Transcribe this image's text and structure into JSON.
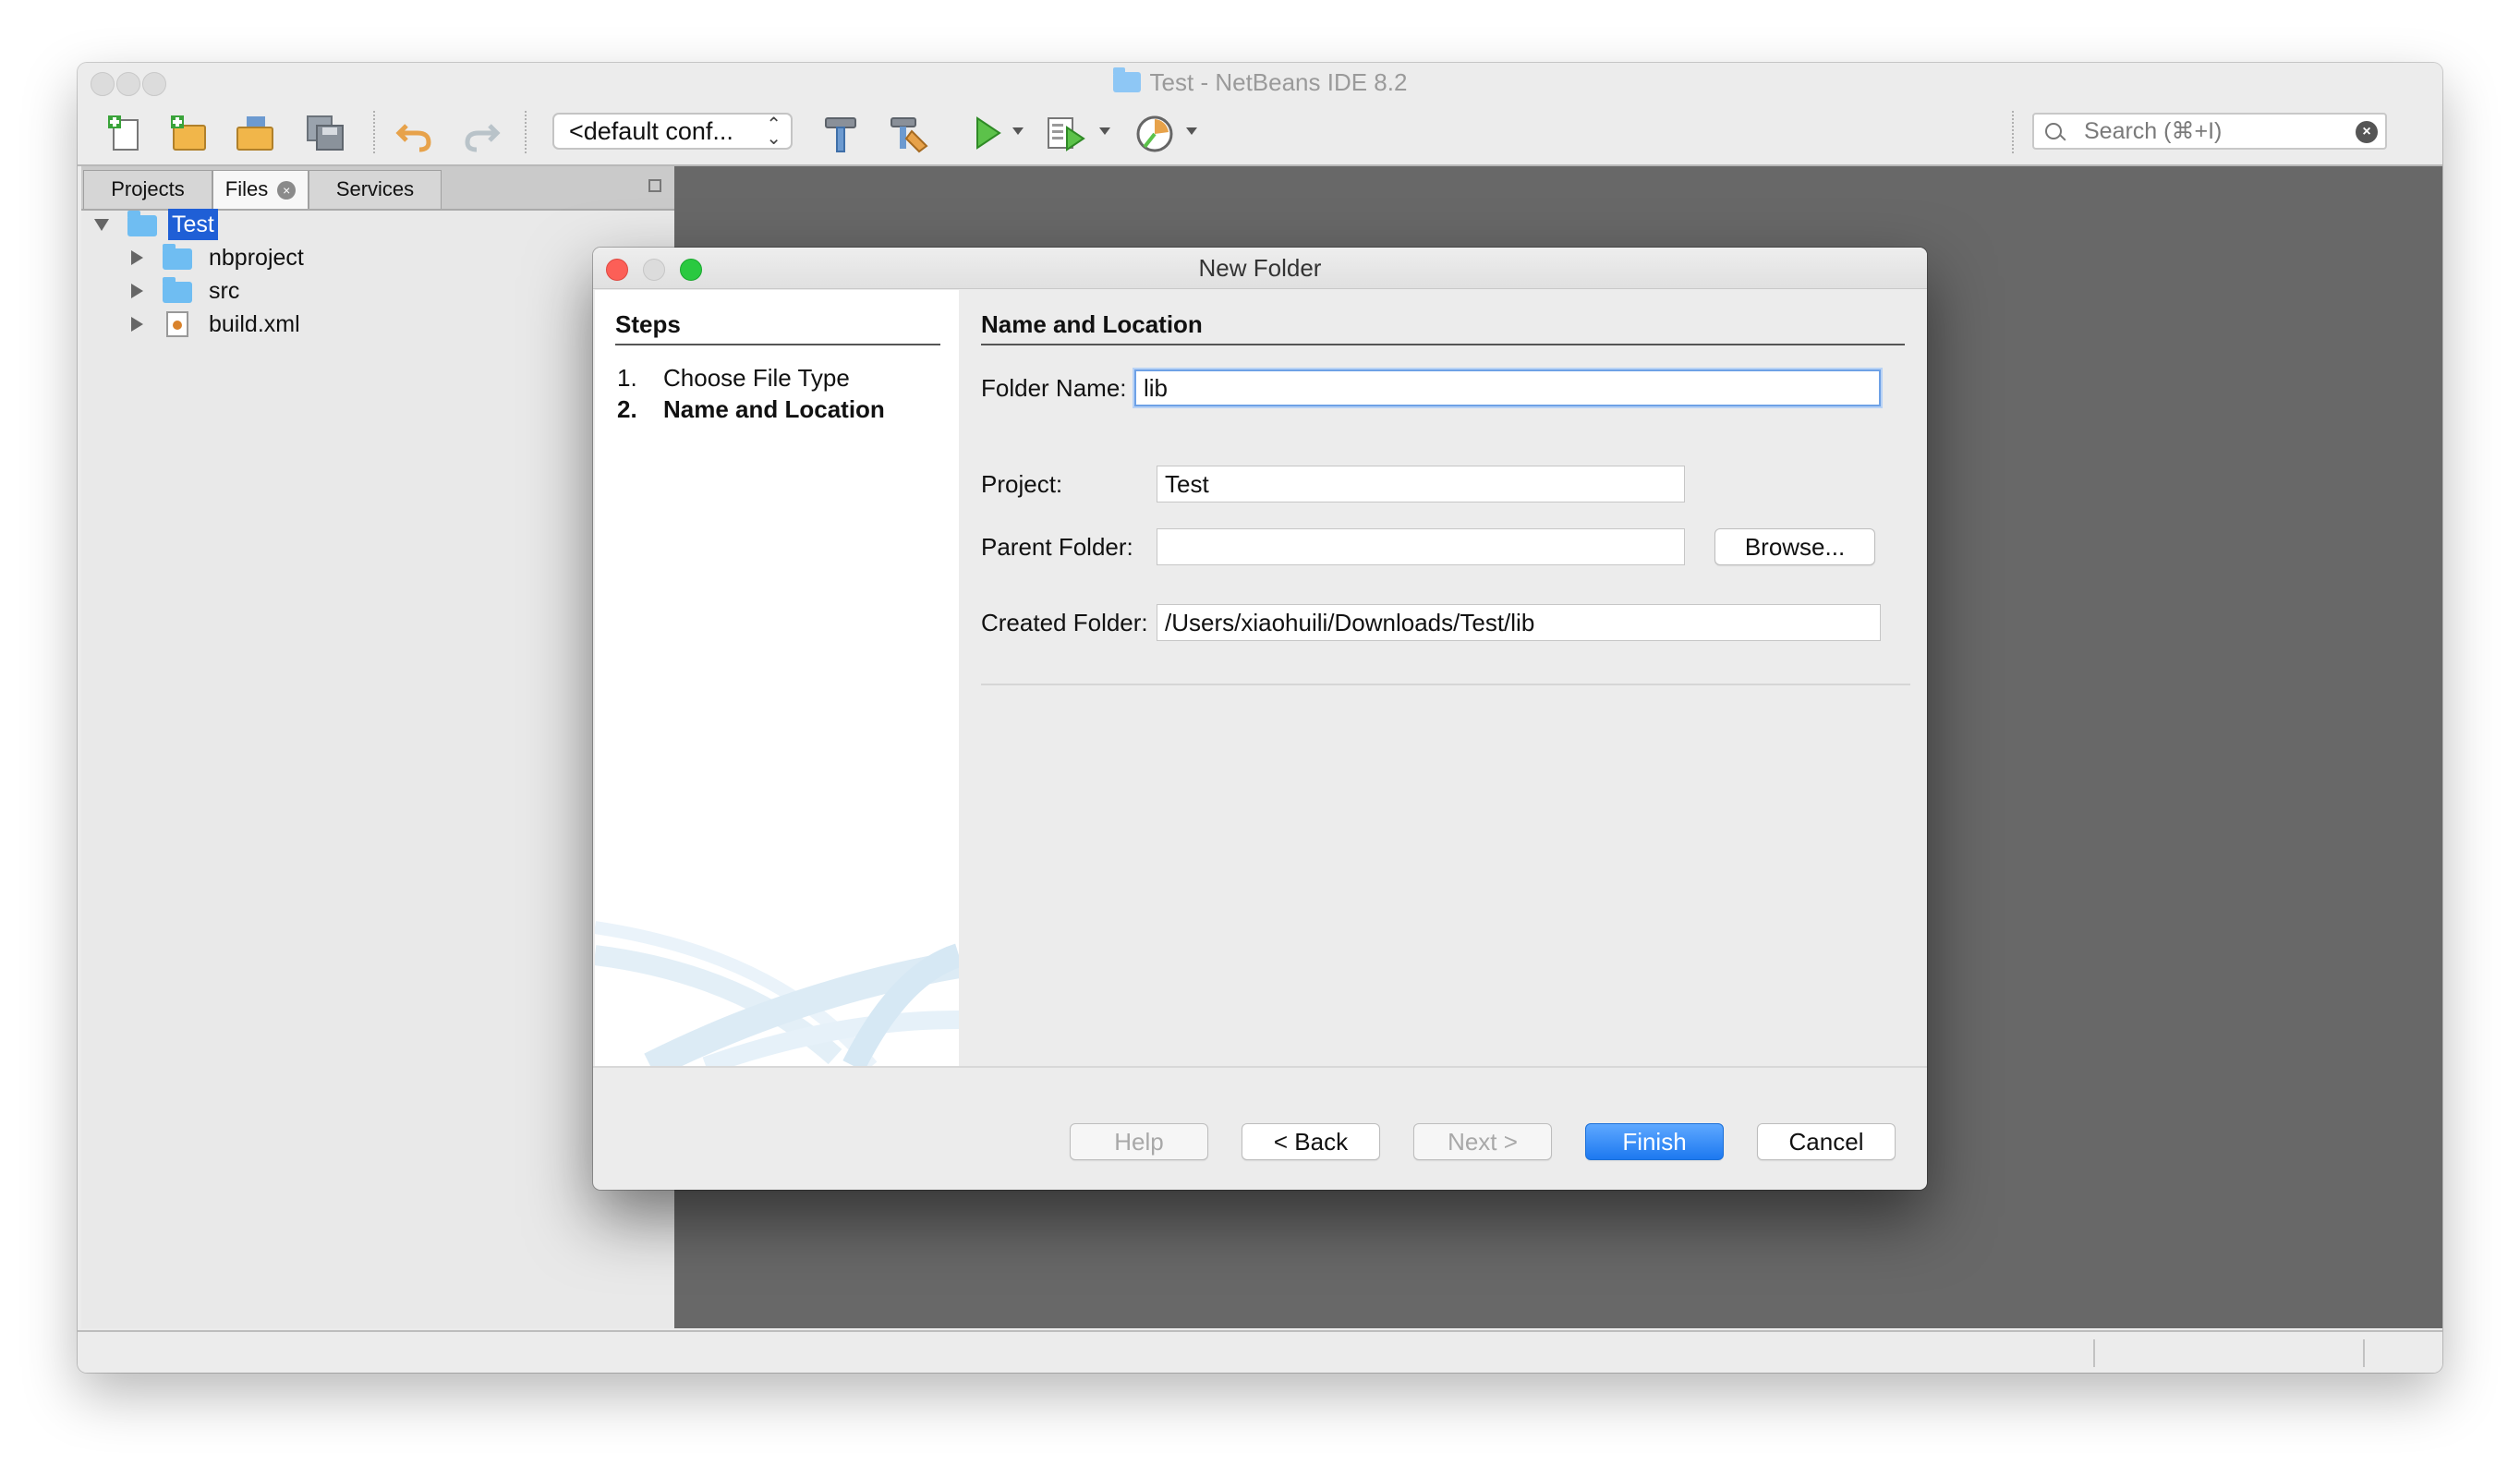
{
  "window": {
    "title": "Test - NetBeans IDE 8.2"
  },
  "toolbar": {
    "icons": [
      "new-file-icon",
      "new-project-icon",
      "open-project-icon",
      "save-all-icon",
      "undo-icon",
      "redo-icon",
      "build-icon",
      "clean-build-icon",
      "run-icon",
      "debug-icon",
      "profile-icon"
    ],
    "config_selected": "<default conf...",
    "search_placeholder": "Search (⌘+I)"
  },
  "left_panel": {
    "tabs": [
      {
        "label": "Projects"
      },
      {
        "label": "Files"
      },
      {
        "label": "Services"
      }
    ],
    "active_tab": "Files",
    "tree": {
      "root": "Test",
      "children": [
        "nbproject",
        "src",
        "build.xml"
      ]
    }
  },
  "dialog": {
    "title": "New Folder",
    "steps_title": "Steps",
    "steps": [
      {
        "num": "1.",
        "label": "Choose File Type"
      },
      {
        "num": "2.",
        "label": "Name and Location"
      }
    ],
    "section_title": "Name and Location",
    "folder_name_label": "Folder Name:",
    "folder_name_value": "lib",
    "project_label": "Project:",
    "project_value": "Test",
    "parent_folder_label": "Parent Folder:",
    "parent_folder_value": "",
    "browse_label": "Browse...",
    "created_folder_label": "Created Folder:",
    "created_folder_value": "/Users/xiaohuili/Downloads/Test/lib",
    "buttons": {
      "help": "Help",
      "back": "< Back",
      "next": "Next >",
      "finish": "Finish",
      "cancel": "Cancel"
    }
  },
  "colors": {
    "accent": "#1d79f0",
    "selection": "#1f5fd6",
    "editor_background": "#686868"
  }
}
